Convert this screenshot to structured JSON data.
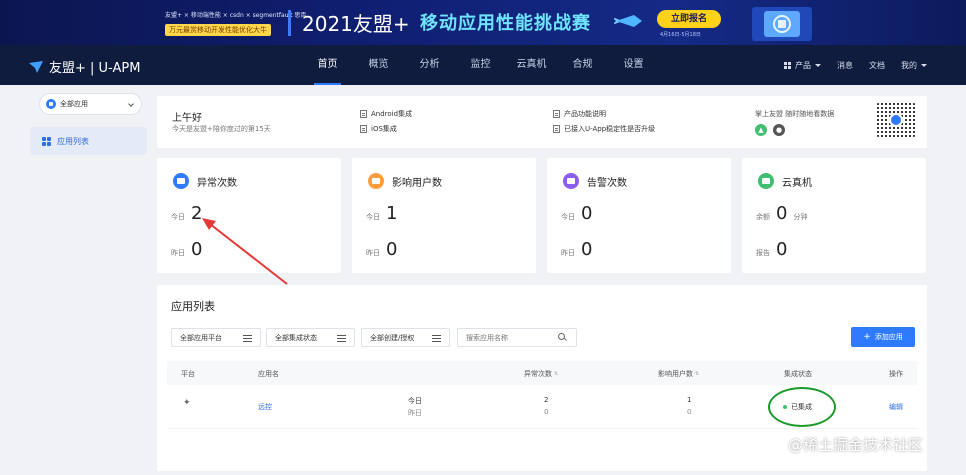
{
  "banner": {
    "sponsors": "友盟+ × 移动端性能 × csdn × segmentfault 思否",
    "tagline": "万元最赏移动开发性能优化大牛",
    "year": "2021友盟+",
    "title": "移动应用性能挑战赛",
    "signup": "立即报名",
    "dates": "4月16日-5月18日"
  },
  "nav": {
    "brand": "友盟+ | U-APM",
    "items": [
      "首页",
      "概览",
      "分析",
      "监控",
      "云真机",
      "合规",
      "设置"
    ],
    "right": {
      "products": "产品",
      "messages": "消息",
      "docs": "文档",
      "mine": "我的"
    }
  },
  "sidebar": {
    "app_select": "全部应用",
    "items": [
      {
        "label": "应用列表"
      }
    ]
  },
  "welcome": {
    "greeting": "上午好",
    "subtitle": "今天是友盟+陪你度过的第15天",
    "links": [
      "Android集成",
      "iOS集成",
      "产品功能说明",
      "已接入U-App稳定性是否升级"
    ],
    "mobile_text": "掌上友盟 随时随地看数据"
  },
  "stats": [
    {
      "title": "异常次数",
      "today_label": "今日",
      "today": "2",
      "yesterday_label": "昨日",
      "yesterday": "0",
      "color": "#2f7bff"
    },
    {
      "title": "影响用户数",
      "today_label": "今日",
      "today": "1",
      "yesterday_label": "昨日",
      "yesterday": "0",
      "color": "#ff9d3c"
    },
    {
      "title": "告警次数",
      "today_label": "今日",
      "today": "0",
      "yesterday_label": "昨日",
      "yesterday": "0",
      "color": "#8a5cf0"
    },
    {
      "title": "云真机",
      "today_label": "余额",
      "today": "0",
      "unit": "分钟",
      "yesterday_label": "报告",
      "yesterday": "0",
      "color": "#3fbf6f"
    }
  ],
  "app_list": {
    "title": "应用列表",
    "filters": [
      "全部应用平台",
      "全部集成状态",
      "全部创建/授权"
    ],
    "search_placeholder": "搜索应用名称",
    "add_button": "添加应用",
    "columns": [
      "平台",
      "应用名",
      "异常次数",
      "影响用户数",
      "集成状态",
      "操作"
    ],
    "rows": [
      {
        "name": "远控",
        "today_label": "今日",
        "yesterday_label": "昨日",
        "crash_today": "2",
        "crash_yesterday": "0",
        "users_today": "1",
        "users_yesterday": "0",
        "status": "已集成",
        "action": "编辑"
      }
    ]
  },
  "watermark": "@稀土掘金技术社区"
}
